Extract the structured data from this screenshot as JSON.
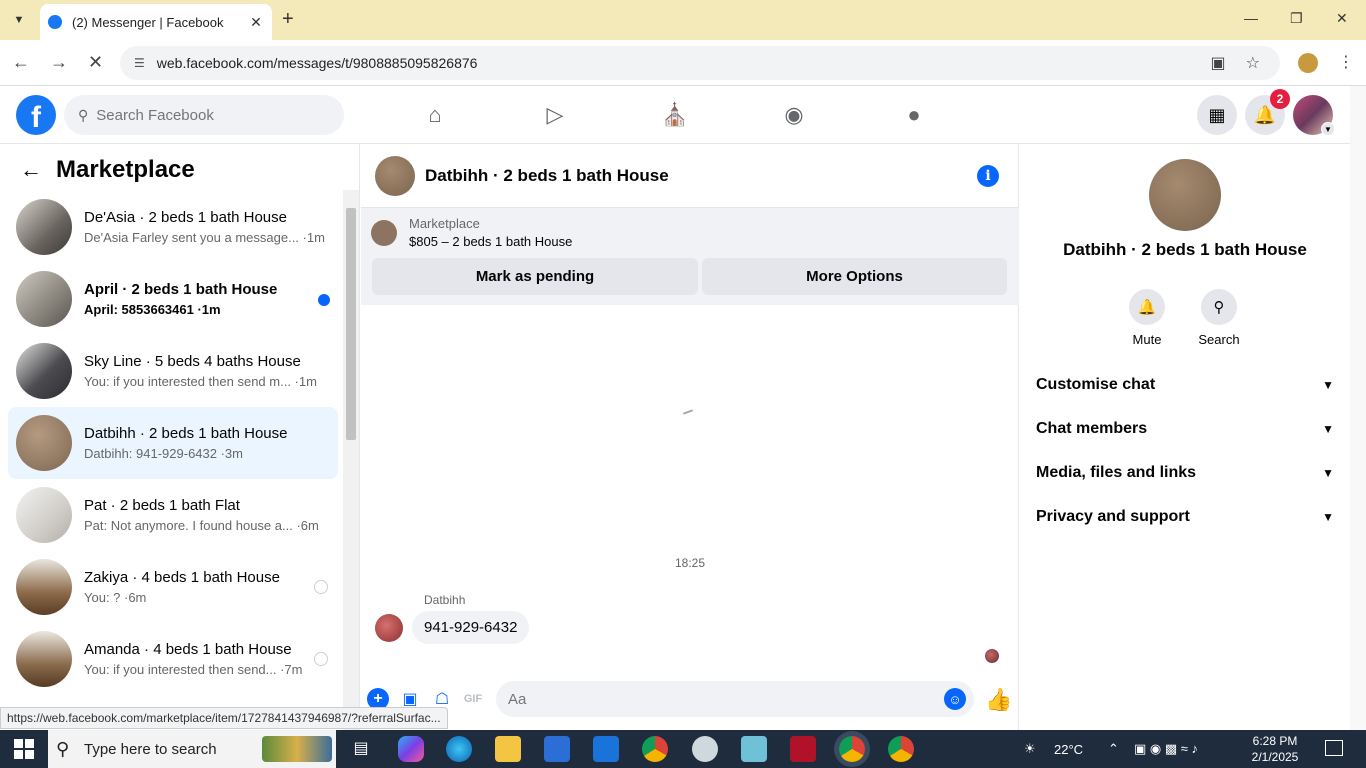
{
  "browser": {
    "tab_title": "(2) Messenger | Facebook",
    "url": "web.facebook.com/messages/t/9808885095826876",
    "status_url": "https://web.facebook.com/marketplace/item/1727841437946987/?referralSurfac..."
  },
  "header": {
    "search_placeholder": "Search Facebook",
    "notification_count": "2"
  },
  "left_panel": {
    "title": "Marketplace",
    "conversations": [
      {
        "name": "De'Asia · 2 beds 1 bath House",
        "snippet": "De'Asia Farley sent you a message... ·1m",
        "unread": false
      },
      {
        "name": "April · 2 beds 1 bath House",
        "snippet": "April: 5853663461 ·1m",
        "unread": true
      },
      {
        "name": "Sky Line · 5 beds 4 baths House",
        "snippet": "You: if you interested then send m... ·1m",
        "unread": false
      },
      {
        "name": "Datbihh · 2 beds 1 bath House",
        "snippet": "Datbihh: 941-929-6432 ·3m",
        "unread": false
      },
      {
        "name": "Pat · 2 beds 1 bath Flat",
        "snippet": "Pat: Not anymore. I found house a... ·6m",
        "unread": false
      },
      {
        "name": "Zakiya · 4 beds 1 bath House",
        "snippet": "You: ? ·6m",
        "unread": false
      },
      {
        "name": "Amanda · 4 beds 1 bath House",
        "snippet": "You: if you interested then send... ·7m",
        "unread": false
      }
    ]
  },
  "chat": {
    "title": "Datbihh · 2 beds 1 bath House",
    "banner_label": "Marketplace",
    "banner_price": "$805 – 2 beds 1 bath House",
    "mark_pending_label": "Mark as pending",
    "more_options_label": "More Options",
    "timestamp": "18:25",
    "sender_name": "Datbihh",
    "message": "941-929-6432",
    "composer_placeholder": "Aa"
  },
  "right_panel": {
    "name": "Datbihh · 2 beds 1 bath House",
    "mute_label": "Mute",
    "search_label": "Search",
    "sections": [
      "Customise chat",
      "Chat members",
      "Media, files and links",
      "Privacy and support"
    ]
  },
  "taskbar": {
    "search_placeholder": "Type here to search",
    "weather": "22°C",
    "time": "6:28 PM",
    "date": "2/1/2025"
  },
  "colors": {
    "brand": "#1877f2",
    "accent": "#0866ff",
    "active_row": "#ebf5ff",
    "tab_strip": "#f3e9b9"
  }
}
